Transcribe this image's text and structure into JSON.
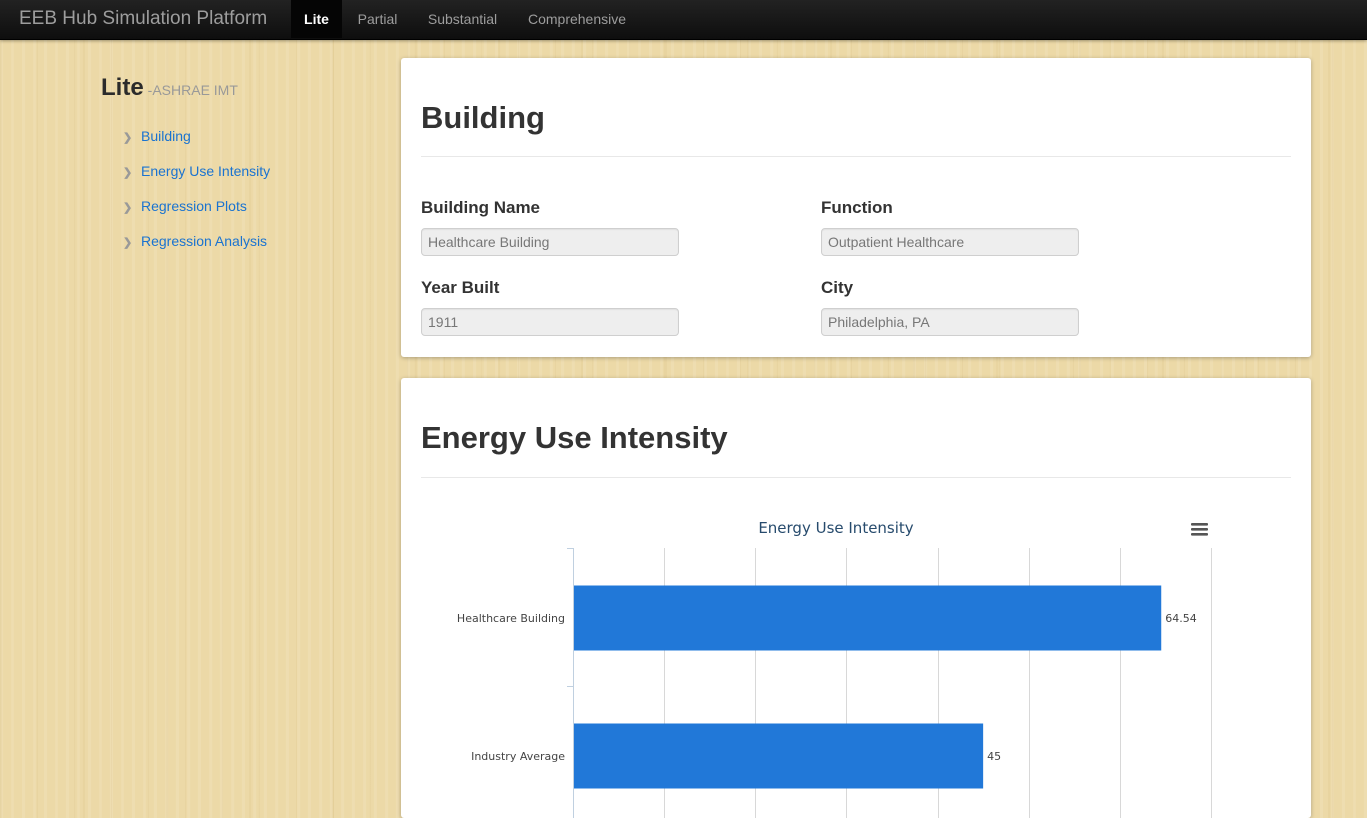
{
  "nav": {
    "brand": "EEB Hub Simulation Platform",
    "tabs": [
      {
        "label": "Lite",
        "active": true
      },
      {
        "label": "Partial",
        "active": false
      },
      {
        "label": "Substantial",
        "active": false
      },
      {
        "label": "Comprehensive",
        "active": false
      }
    ]
  },
  "sidebar": {
    "title": "Lite",
    "subtitle": "-ASHRAE IMT",
    "items": [
      {
        "label": "Building",
        "icon": "chevron-right-icon"
      },
      {
        "label": "Energy Use Intensity",
        "icon": "chevron-right-icon"
      },
      {
        "label": "Regression Plots",
        "icon": "chevron-right-icon"
      },
      {
        "label": "Regression Analysis",
        "icon": "chevron-right-icon"
      }
    ]
  },
  "building": {
    "title": "Building",
    "name_label": "Building Name",
    "name_value": "Healthcare Building",
    "function_label": "Function",
    "function_value": "Outpatient Healthcare",
    "year_label": "Year Built",
    "year_value": "1911",
    "city_label": "City",
    "city_value": "Philadelphia, PA"
  },
  "eui": {
    "title": "Energy Use Intensity",
    "menu_icon": "hamburger-menu-icon"
  },
  "colors": {
    "bar": "#2178d8",
    "link": "#1a73d0",
    "chart_title": "#274b6d"
  },
  "chart_data": {
    "type": "bar",
    "orientation": "horizontal",
    "title": "Energy Use Intensity",
    "categories": [
      "Healthcare Building",
      "Industry Average"
    ],
    "values": [
      64.54,
      45
    ],
    "data_labels": [
      "64.54",
      "45"
    ],
    "xlim": [
      0,
      70
    ],
    "grid": true,
    "legend": "none"
  }
}
